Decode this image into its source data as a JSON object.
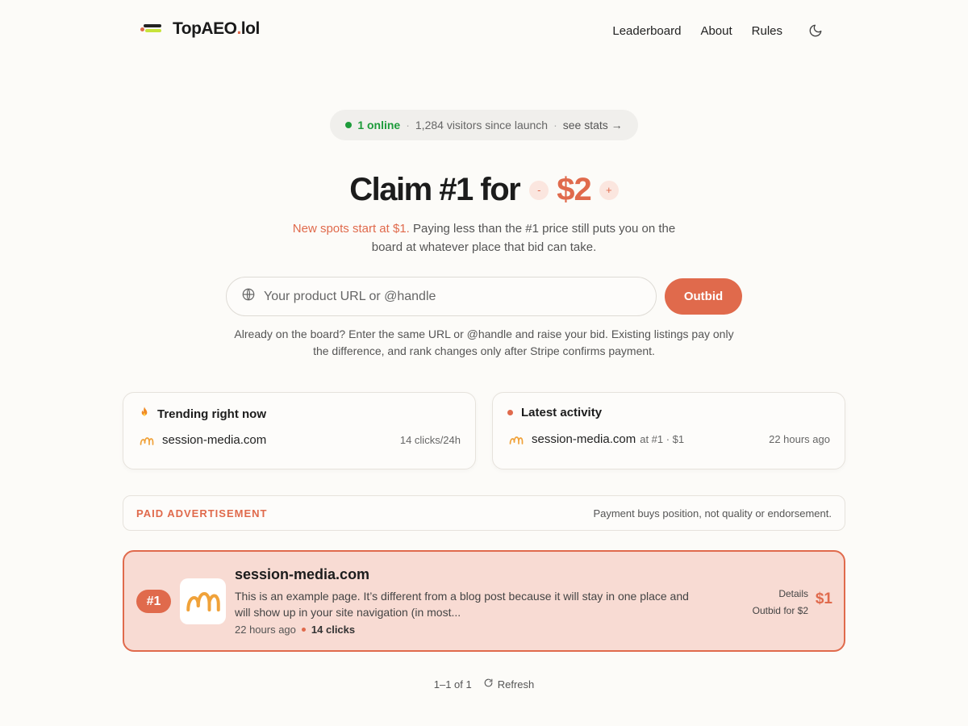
{
  "brand": {
    "name": "TopAEO",
    "tld": "lol"
  },
  "nav": {
    "items": [
      {
        "label": "Leaderboard"
      },
      {
        "label": "About"
      },
      {
        "label": "Rules"
      }
    ]
  },
  "stats": {
    "online": "1 online",
    "visitors": "1,284 visitors since launch",
    "link": "see stats →"
  },
  "hero": {
    "title": "Claim #1 for",
    "decrement": "-",
    "increment": "+",
    "price": "$2",
    "sub_accent": "New spots start at $1.",
    "sub_rest": " Paying less than the #1 price still puts you on the board at whatever place that bid can take."
  },
  "form": {
    "placeholder": "Your product URL or @handle",
    "submit": "Outbid",
    "helper": "Already on the board? Enter the same URL or @handle and raise your bid. Existing listings pay only the difference, and rank changes only after Stripe confirms payment."
  },
  "trending": {
    "title": "Trending right now",
    "icon": "fire-icon",
    "items": [
      {
        "site": "session-media.com",
        "stat": "14 clicks/24h"
      }
    ]
  },
  "latest": {
    "title": "Latest activity",
    "items": [
      {
        "site": "session-media.com",
        "detail": "at #1 · $1",
        "time": "22 hours ago"
      }
    ]
  },
  "ad": {
    "label": "PAID ADVERTISEMENT",
    "note": "Payment buys position, not quality or endorsement."
  },
  "listings": [
    {
      "rank": "#1",
      "name": "session-media.com",
      "description": "This is an example page. It’s different from a blog post because it will stay in one place and will show up in your site navigation (in most...",
      "time": "22 hours ago",
      "clicks": "14 clicks",
      "details": "Details",
      "outbid": "Outbid for $2",
      "price": "$1"
    }
  ],
  "pager": {
    "range": "1–1 of 1",
    "refresh": "Refresh"
  },
  "colors": {
    "accent": "#e06a4c",
    "online": "#1d9b3a",
    "lime": "#c7e33a",
    "listing_bg": "#f8dbd3"
  }
}
